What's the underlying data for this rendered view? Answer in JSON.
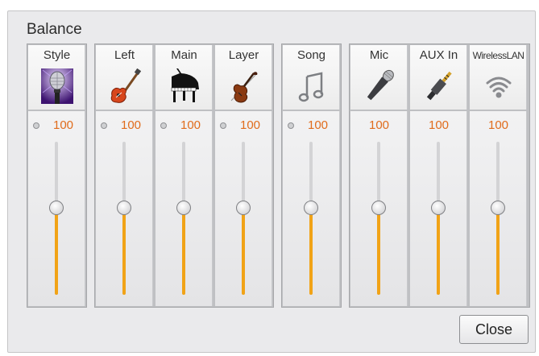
{
  "window": {
    "title": "Balance"
  },
  "channels": [
    {
      "name": "Style",
      "icon": "microphone-stage-icon",
      "value": "100",
      "level": 0.57,
      "indicator": true
    },
    {
      "name": "Left",
      "icon": "electric-guitar-icon",
      "value": "100",
      "level": 0.57,
      "indicator": true
    },
    {
      "name": "Main",
      "icon": "grand-piano-icon",
      "value": "100",
      "level": 0.57,
      "indicator": true
    },
    {
      "name": "Layer",
      "icon": "violin-icon",
      "value": "100",
      "level": 0.57,
      "indicator": true
    },
    {
      "name": "Song",
      "icon": "music-note-icon",
      "value": "100",
      "level": 0.57,
      "indicator": true
    },
    {
      "name": "Mic",
      "icon": "microphone-icon",
      "value": "100",
      "level": 0.57,
      "indicator": false
    },
    {
      "name": "AUX In",
      "icon": "audio-jack-icon",
      "value": "100",
      "level": 0.57,
      "indicator": false
    },
    {
      "name": "WirelessLAN",
      "icon": "wireless-icon",
      "value": "100",
      "level": 0.57,
      "indicator": false
    }
  ],
  "buttons": {
    "close_label": "Close"
  },
  "colors": {
    "value_text": "#e06c1c",
    "fader_fill": "#f1a317"
  }
}
